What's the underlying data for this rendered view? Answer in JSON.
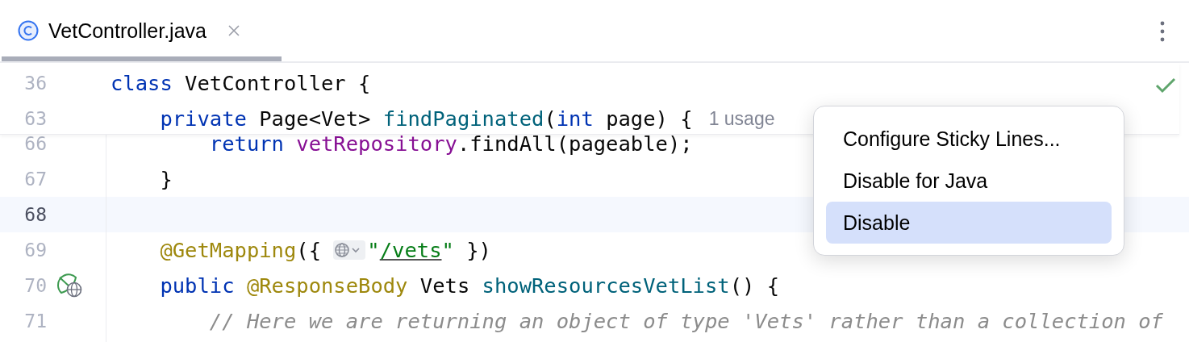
{
  "tabs": [
    {
      "label": "VetController.java",
      "selected": true
    }
  ],
  "sticky_lines": [
    {
      "number": "36",
      "tokens": [
        {
          "kind": "keyword",
          "text": "class"
        },
        {
          "kind": "plain",
          "text": " VetController {"
        }
      ]
    },
    {
      "number": "63",
      "tokens": [
        {
          "kind": "keyword",
          "text": "    private"
        },
        {
          "kind": "plain",
          "text": " Page<Vet> "
        },
        {
          "kind": "method",
          "text": "findPaginated"
        },
        {
          "kind": "plain",
          "text": "("
        },
        {
          "kind": "keyword",
          "text": "int"
        },
        {
          "kind": "plain",
          "text": " page) {"
        }
      ],
      "hint": "1 usage"
    }
  ],
  "lines": [
    {
      "number": "66",
      "current": false,
      "tokens": [
        {
          "kind": "keyword",
          "text": "        return "
        },
        {
          "kind": "field",
          "text": "vetRepository"
        },
        {
          "kind": "plain",
          "text": ".findAll(pageable);"
        }
      ]
    },
    {
      "number": "67",
      "current": false,
      "tokens": [
        {
          "kind": "plain",
          "text": "    }"
        }
      ]
    },
    {
      "number": "68",
      "current": true
    },
    {
      "number": "69",
      "current": false,
      "tokens": [
        {
          "kind": "annotation",
          "text": "    @GetMapping"
        },
        {
          "kind": "plain",
          "text": "({ "
        },
        {
          "kind": "inlay"
        },
        {
          "kind": "string",
          "text": "\""
        },
        {
          "kind": "link",
          "text": "/vets"
        },
        {
          "kind": "string",
          "text": "\""
        },
        {
          "kind": "plain",
          "text": " })"
        }
      ]
    },
    {
      "number": "70",
      "current": false,
      "gutter_icon": true,
      "tokens": [
        {
          "kind": "keyword",
          "text": "    public "
        },
        {
          "kind": "annotation",
          "text": "@ResponseBody"
        },
        {
          "kind": "plain",
          "text": " Vets "
        },
        {
          "kind": "method",
          "text": "showResourcesVetList"
        },
        {
          "kind": "plain",
          "text": "() {"
        }
      ]
    },
    {
      "number": "71",
      "current": false,
      "tokens": [
        {
          "kind": "comment",
          "text": "        // Here we are returning an object of type 'Vets' rather than a collection of"
        }
      ]
    }
  ],
  "context_menu": [
    {
      "label": "Configure Sticky Lines...",
      "selected": false
    },
    {
      "label": "Disable for Java",
      "selected": false
    },
    {
      "label": "Disable",
      "selected": true
    }
  ]
}
